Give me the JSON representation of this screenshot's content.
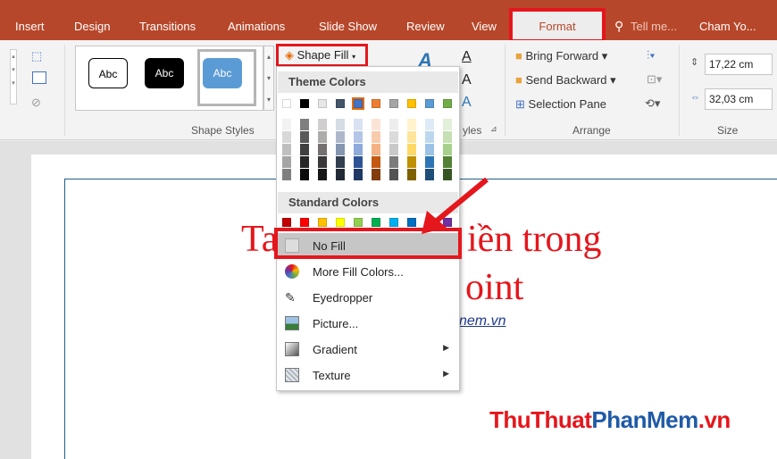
{
  "ribbon_tabs": [
    "Insert",
    "Design",
    "Transitions",
    "Animations",
    "Slide Show",
    "Review",
    "View"
  ],
  "active_tab": "Format",
  "tell_me": "Tell me...",
  "user_name": "Cham Yo...",
  "shape_styles": {
    "samples": [
      "Abc",
      "Abc",
      "Abc"
    ],
    "group_label": "Shape Styles",
    "group_label_partial": "yles"
  },
  "shape_fill_label": "Shape Fill",
  "arrange": {
    "bring_forward": "Bring Forward",
    "send_backward": "Send Backward",
    "selection_pane": "Selection Pane",
    "group_label": "Arrange"
  },
  "size": {
    "height": "17,22 cm",
    "width": "32,03 cm",
    "group_label": "Size"
  },
  "dropdown": {
    "theme_colors_header": "Theme Colors",
    "standard_colors_header": "Standard Colors",
    "theme_top_row": [
      "#ffffff",
      "#000000",
      "#e7e6e6",
      "#44546a",
      "#4472c4",
      "#ed7d31",
      "#a5a5a5",
      "#ffc000",
      "#5b9bd5",
      "#70ad47"
    ],
    "theme_shade_rows": [
      [
        "#f2f2f2",
        "#7f7f7f",
        "#d0cece",
        "#d6dce4",
        "#d9e2f3",
        "#fbe4d5",
        "#ededed",
        "#fff2cc",
        "#deebf6",
        "#e2efd9"
      ],
      [
        "#d8d8d8",
        "#595959",
        "#aeabab",
        "#adb9ca",
        "#b4c6e7",
        "#f7cbac",
        "#dbdbdb",
        "#fee599",
        "#bdd7ee",
        "#c5e0b3"
      ],
      [
        "#bfbfbf",
        "#3f3f3f",
        "#757070",
        "#8496b0",
        "#8eaadb",
        "#f4b183",
        "#c9c9c9",
        "#ffd965",
        "#9cc3e5",
        "#a8d08d"
      ],
      [
        "#a5a5a5",
        "#262626",
        "#3a3838",
        "#323f4f",
        "#2e5395",
        "#c45911",
        "#7b7b7b",
        "#bf9000",
        "#2e75b5",
        "#538135"
      ],
      [
        "#7f7f7f",
        "#0c0c0c",
        "#171616",
        "#222a35",
        "#1f3864",
        "#833c0b",
        "#525252",
        "#7f6000",
        "#1f4e79",
        "#375623"
      ]
    ],
    "standard_colors": [
      "#c00000",
      "#ff0000",
      "#ffc000",
      "#ffff00",
      "#92d050",
      "#00b050",
      "#00b0f0",
      "#0070c0",
      "#002060",
      "#7030a0"
    ],
    "items": [
      {
        "label": "No Fill",
        "icon": "no-fill-icon"
      },
      {
        "label": "More Fill Colors...",
        "icon": "color-wheel-icon"
      },
      {
        "label": "Eyedropper",
        "icon": "eyedropper-icon"
      },
      {
        "label": "Picture...",
        "icon": "picture-icon"
      },
      {
        "label": "Gradient",
        "icon": "gradient-icon"
      },
      {
        "label": "Texture",
        "icon": "texture-icon"
      }
    ]
  },
  "slide": {
    "title_line1_start": "Ta",
    "title_line1_end": "iền trong",
    "title_line2_end": "oint",
    "link_text": "nem.vn"
  },
  "watermark": {
    "part1": "ThuThuat",
    "part2": "PhanMem",
    "part3": ".vn"
  },
  "colors": {
    "accent": "#b7472a",
    "highlight": "#e5161c",
    "watermark_red": "#e5161c",
    "watermark_blue": "#1f5aa6"
  }
}
